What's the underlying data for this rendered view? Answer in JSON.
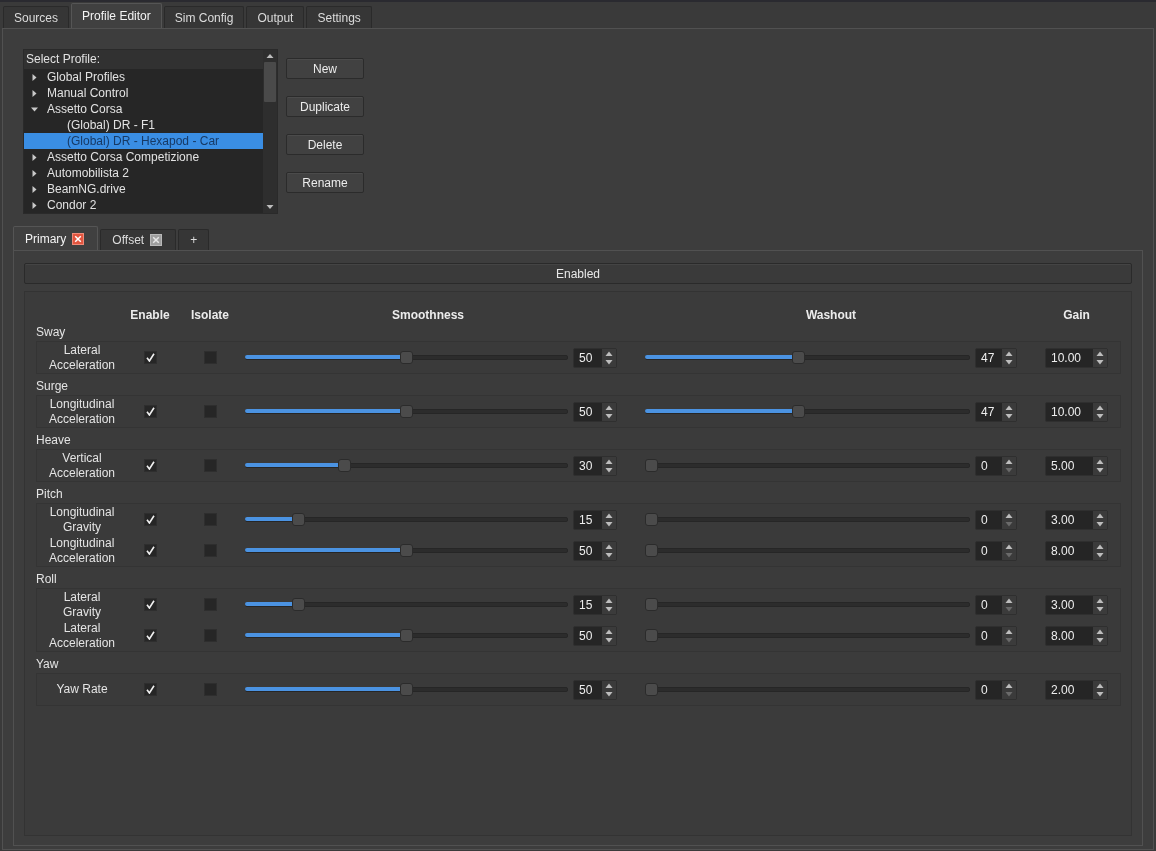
{
  "main_tabs": [
    {
      "label": "Sources",
      "selected": false
    },
    {
      "label": "Profile Editor",
      "selected": true
    },
    {
      "label": "Sim Config",
      "selected": false
    },
    {
      "label": "Output",
      "selected": false
    },
    {
      "label": "Settings",
      "selected": false
    }
  ],
  "profile_list": {
    "header": "Select Profile:",
    "items": [
      {
        "label": "Global Profiles",
        "expanded": false,
        "selected": false
      },
      {
        "label": "Manual Control",
        "expanded": false,
        "selected": false
      },
      {
        "label": "Assetto Corsa",
        "expanded": true,
        "selected": false,
        "children": [
          {
            "label": "(Global) DR - F1",
            "selected": false
          },
          {
            "label": "(Global) DR - Hexapod - Car",
            "selected": true
          }
        ]
      },
      {
        "label": "Assetto Corsa Competizione",
        "expanded": false,
        "selected": false
      },
      {
        "label": "Automobilista 2",
        "expanded": false,
        "selected": false
      },
      {
        "label": "BeamNG.drive",
        "expanded": false,
        "selected": false
      },
      {
        "label": "Condor 2",
        "expanded": false,
        "selected": false
      }
    ]
  },
  "profile_buttons": [
    "New",
    "Duplicate",
    "Delete",
    "Rename"
  ],
  "axis_tabs": [
    {
      "kind": "tab",
      "label": "Primary",
      "selected": true
    },
    {
      "kind": "tab",
      "label": "Offset",
      "selected": false
    },
    {
      "kind": "add",
      "label": "+",
      "selected": false
    }
  ],
  "enabled_toggle": "Enabled",
  "column_headers": [
    "Enable",
    "Isolate",
    "Smoothness",
    "Washout",
    "Gain"
  ],
  "groups": [
    {
      "name": "Sway",
      "rows": [
        {
          "label": "Lateral Acceleration",
          "enable": true,
          "isolate": false,
          "smoothness": {
            "level": 0.5,
            "reading": "50"
          },
          "washout": {
            "level": 0.47,
            "reading": "47"
          },
          "gain": "10.00"
        }
      ]
    },
    {
      "name": "Surge",
      "rows": [
        {
          "label": "Longitudinal Acceleration",
          "enable": true,
          "isolate": false,
          "smoothness": {
            "level": 0.5,
            "reading": "50"
          },
          "washout": {
            "level": 0.47,
            "reading": "47"
          },
          "gain": "10.00"
        }
      ]
    },
    {
      "name": "Heave",
      "rows": [
        {
          "label": "Vertical Acceleration",
          "enable": true,
          "isolate": false,
          "smoothness": {
            "level": 0.3,
            "reading": "30"
          },
          "washout": {
            "level": 0,
            "reading": "0"
          },
          "gain": "5.00"
        }
      ]
    },
    {
      "name": "Pitch",
      "rows": [
        {
          "label": "Longitudinal Gravity",
          "enable": true,
          "isolate": false,
          "smoothness": {
            "level": 0.15,
            "reading": "15"
          },
          "washout": {
            "level": 0,
            "reading": "0"
          },
          "gain": "3.00"
        },
        {
          "label": "Longitudinal Acceleration",
          "enable": true,
          "isolate": false,
          "smoothness": {
            "level": 0.5,
            "reading": "50"
          },
          "washout": {
            "level": 0,
            "reading": "0"
          },
          "gain": "8.00"
        }
      ]
    },
    {
      "name": "Roll",
      "rows": [
        {
          "label": "Lateral Gravity",
          "enable": true,
          "isolate": false,
          "smoothness": {
            "level": 0.15,
            "reading": "15"
          },
          "washout": {
            "level": 0,
            "reading": "0"
          },
          "gain": "3.00"
        },
        {
          "label": "Lateral Acceleration",
          "enable": true,
          "isolate": false,
          "smoothness": {
            "level": 0.5,
            "reading": "50"
          },
          "washout": {
            "level": 0,
            "reading": "0"
          },
          "gain": "8.00"
        }
      ]
    },
    {
      "name": "Yaw",
      "rows": [
        {
          "label": "Yaw Rate",
          "enable": true,
          "isolate": false,
          "smoothness": {
            "level": 0.5,
            "reading": "50"
          },
          "washout": {
            "level": 0,
            "reading": "0"
          },
          "gain": "2.00"
        }
      ]
    }
  ]
}
